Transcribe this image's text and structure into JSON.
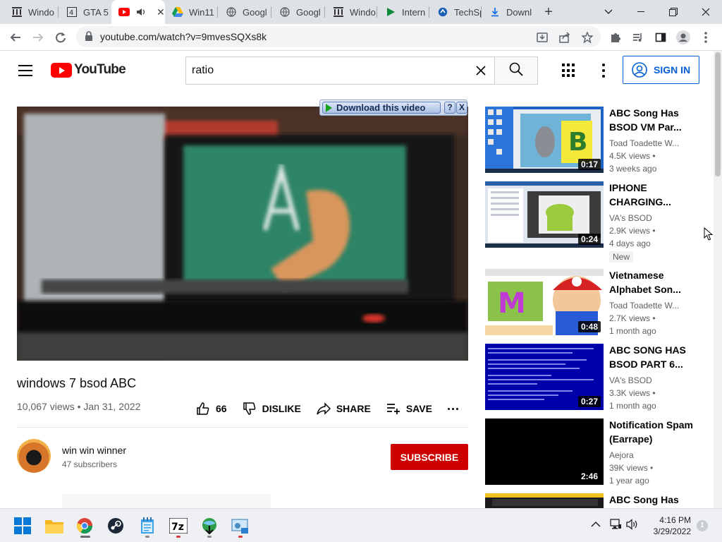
{
  "browser": {
    "tabs": [
      {
        "label": "Windo",
        "icon": "archive-org-icon"
      },
      {
        "label": "GTA 5",
        "icon": "wiki-icon"
      },
      {
        "label": "",
        "icon": "youtube-icon",
        "audio": "speaker-icon"
      },
      {
        "label": "Win11",
        "icon": "google-drive-icon"
      },
      {
        "label": "Googl",
        "icon": "globe-icon"
      },
      {
        "label": "Googl",
        "icon": "globe-icon"
      },
      {
        "label": "Windo",
        "icon": "archive-org-icon"
      },
      {
        "label": "Intern",
        "icon": "play-arrow-icon"
      },
      {
        "label": "TechSp",
        "icon": "techspot-icon"
      },
      {
        "label": "Downl",
        "icon": "download-icon"
      }
    ],
    "url": "youtube.com/watch?v=9mvesSQXs8k"
  },
  "youtube": {
    "logo_text": "YouTube",
    "search_query": "ratio",
    "signin_label": "SIGN IN"
  },
  "video": {
    "download_label": "Download this video",
    "help_label": "?",
    "close_label": "X",
    "title": "windows 7 bsod ABC",
    "meta": "10,067 views • Jan 31, 2022",
    "likes": "66",
    "dislike_label": "DISLIKE",
    "share_label": "SHARE",
    "save_label": "SAVE"
  },
  "channel": {
    "name": "win win winner",
    "subscribers": "47 subscribers",
    "subscribe_label": "SUBSCRIBE"
  },
  "recommendations": [
    {
      "title": "ABC Song Has BSOD VM Par...",
      "channel": "Toad Toadette W...",
      "views": "4.5K views •",
      "age": "3 weeks ago",
      "duration": "0:17",
      "badge": ""
    },
    {
      "title": "IPHONE CHARGING...",
      "channel": "VA's BSOD",
      "views": "2.9K views •",
      "age": "4 days ago",
      "duration": "0:24",
      "badge": "New"
    },
    {
      "title": "Vietnamese Alphabet Son...",
      "channel": "Toad Toadette W...",
      "views": "2.7K views •",
      "age": "1 month ago",
      "duration": "0:48",
      "badge": ""
    },
    {
      "title": "ABC SONG HAS BSOD PART 6...",
      "channel": "VA's BSOD",
      "views": "3.3K views •",
      "age": "1 month ago",
      "duration": "0:27",
      "badge": ""
    },
    {
      "title": "Notification Spam (Earrape)",
      "channel": "Aejora",
      "views": "39K views •",
      "age": "1 year ago",
      "duration": "2:46",
      "badge": ""
    },
    {
      "title": "ABC Song Has",
      "channel": "",
      "views": "",
      "age": "",
      "duration": "",
      "badge": ""
    }
  ],
  "taskbar": {
    "time": "4:16 PM",
    "date": "3/29/2022",
    "notification_count": "1"
  }
}
